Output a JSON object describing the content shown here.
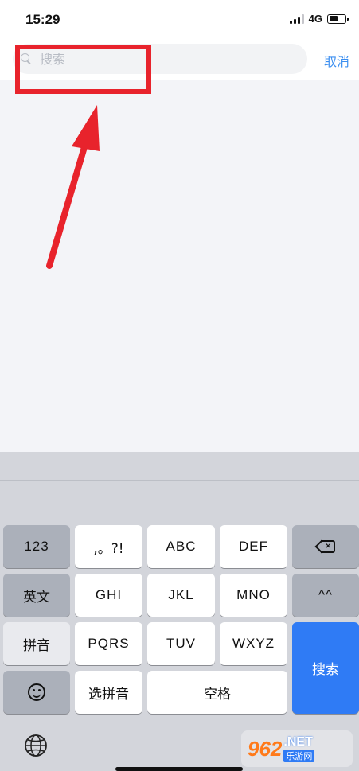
{
  "status": {
    "time": "15:29",
    "network": "4G"
  },
  "search": {
    "placeholder": "搜索",
    "value": "",
    "cancel_label": "取消"
  },
  "colors": {
    "accent": "#3a8ef0",
    "annotation": "#e8232c",
    "search_key": "#2f7bf5"
  },
  "keyboard": {
    "row1": {
      "num": "123",
      "punct": ",。?!",
      "k2": "ABC",
      "k3": "DEF"
    },
    "row2": {
      "english": "英文",
      "k4": "GHI",
      "k5": "JKL",
      "k6": "MNO",
      "face": "^^"
    },
    "row3": {
      "pinyin": "拼音",
      "k7": "PQRS",
      "k8": "TUV",
      "k9": "WXYZ",
      "search": "搜索"
    },
    "row4": {
      "select": "选拼音",
      "space": "空格"
    },
    "icons": {
      "backspace": "backspace-icon",
      "emoji": "emoji-icon",
      "globe": "globe-icon"
    }
  },
  "watermark": {
    "logo": "962",
    "net": ".NET",
    "cn": "乐游网"
  }
}
